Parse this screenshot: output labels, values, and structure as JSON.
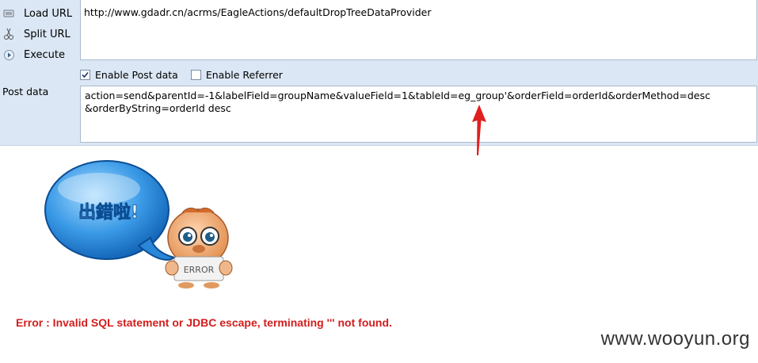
{
  "menu": {
    "items": [
      {
        "label": "Load URL",
        "icon": "load-url-icon"
      },
      {
        "label": "Split URL",
        "icon": "split-url-icon"
      },
      {
        "label": "Execute",
        "icon": "execute-icon"
      }
    ]
  },
  "url": {
    "value": "http://www.gdadr.cn/acrms/EagleActions/defaultDropTreeDataProvider"
  },
  "options": {
    "enable_post_label": "Enable Post data",
    "enable_post_checked": true,
    "enable_referrer_label": "Enable Referrer",
    "enable_referrer_checked": false
  },
  "post": {
    "label": "Post data",
    "line1": "action=send&parentId=-1&labelField=groupName&valueField=1&tableId=eg_group'&orderField=orderId&orderMethod=desc",
    "line2": "&orderByString=orderId desc"
  },
  "illustration": {
    "bubble_text": "出錯啦!",
    "sign_text": "ERROR"
  },
  "error": {
    "message": "Error : Invalid SQL statement or JDBC escape, terminating ''' not found."
  },
  "watermark": "www.wooyun.org",
  "colors": {
    "panel_bg": "#dbe7f4",
    "error_red": "#d31d1d",
    "arrow_red": "#e02020"
  }
}
